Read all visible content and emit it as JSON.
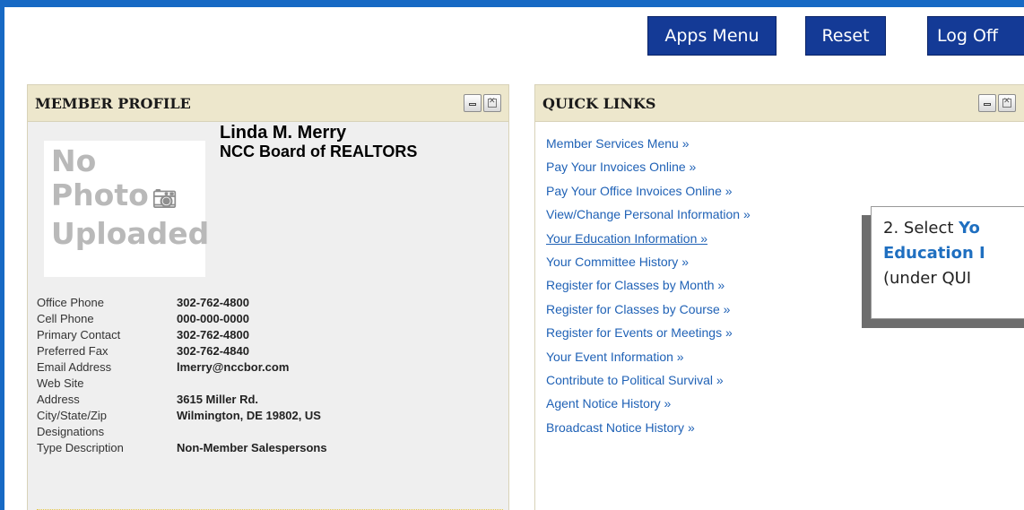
{
  "toolbar": {
    "apps_menu_label": "Apps Menu",
    "reset_label": "Reset",
    "logoff_label": "Log Off"
  },
  "profile": {
    "title": "MEMBER PROFILE",
    "photo_placeholder_line1": "No",
    "photo_placeholder_line2": "Photo",
    "photo_placeholder_line3": "Uploaded",
    "name": "Linda M. Merry",
    "organization": "NCC Board of REALTORS",
    "fields": [
      {
        "label": "Office Phone",
        "value": "302-762-4800"
      },
      {
        "label": "Cell Phone",
        "value": "000-000-0000"
      },
      {
        "label": "Primary Contact",
        "value": "302-762-4800"
      },
      {
        "label": "Preferred Fax",
        "value": "302-762-4840"
      },
      {
        "label": "Email Address",
        "value": "lmerry@nccbor.com"
      },
      {
        "label": "Web Site",
        "value": ""
      },
      {
        "label": "Address",
        "value": "3615 Miller Rd."
      },
      {
        "label": "City/State/Zip",
        "value": "Wilmington, DE 19802, US"
      },
      {
        "label": "Designations",
        "value": ""
      },
      {
        "label": "Type Description",
        "value": "Non-Member Salespersons"
      }
    ]
  },
  "quick_links": {
    "title": "QUICK LINKS",
    "items": [
      {
        "label": "Member Services Menu »"
      },
      {
        "label": "Pay Your Invoices Online »"
      },
      {
        "label": "Pay Your Office Invoices Online »"
      },
      {
        "label": "View/Change Personal Information »"
      },
      {
        "label": "Your Education Information »"
      },
      {
        "label": "Your Committee History »"
      },
      {
        "label": "Register for Classes by Month »"
      },
      {
        "label": "Register for Classes by Course »"
      },
      {
        "label": "Register for Events or Meetings »"
      },
      {
        "label": "Your Event Information »"
      },
      {
        "label": "Contribute to Political Survival »"
      },
      {
        "label": "Agent Notice History »"
      },
      {
        "label": "Broadcast Notice History »"
      }
    ]
  },
  "callout": {
    "line1_prefix": "2.  Select ",
    "line1_highlight": "Yo",
    "line2_highlight": "Education I",
    "line3": "(under QUI"
  },
  "icons": {
    "minimize": "minimize-icon",
    "close": "close-icon",
    "camera": "camera-icon"
  },
  "colors": {
    "frame": "#1769c4",
    "button_bg": "#143a96",
    "panel_header": "#ede7cc",
    "link": "#2062b6"
  }
}
